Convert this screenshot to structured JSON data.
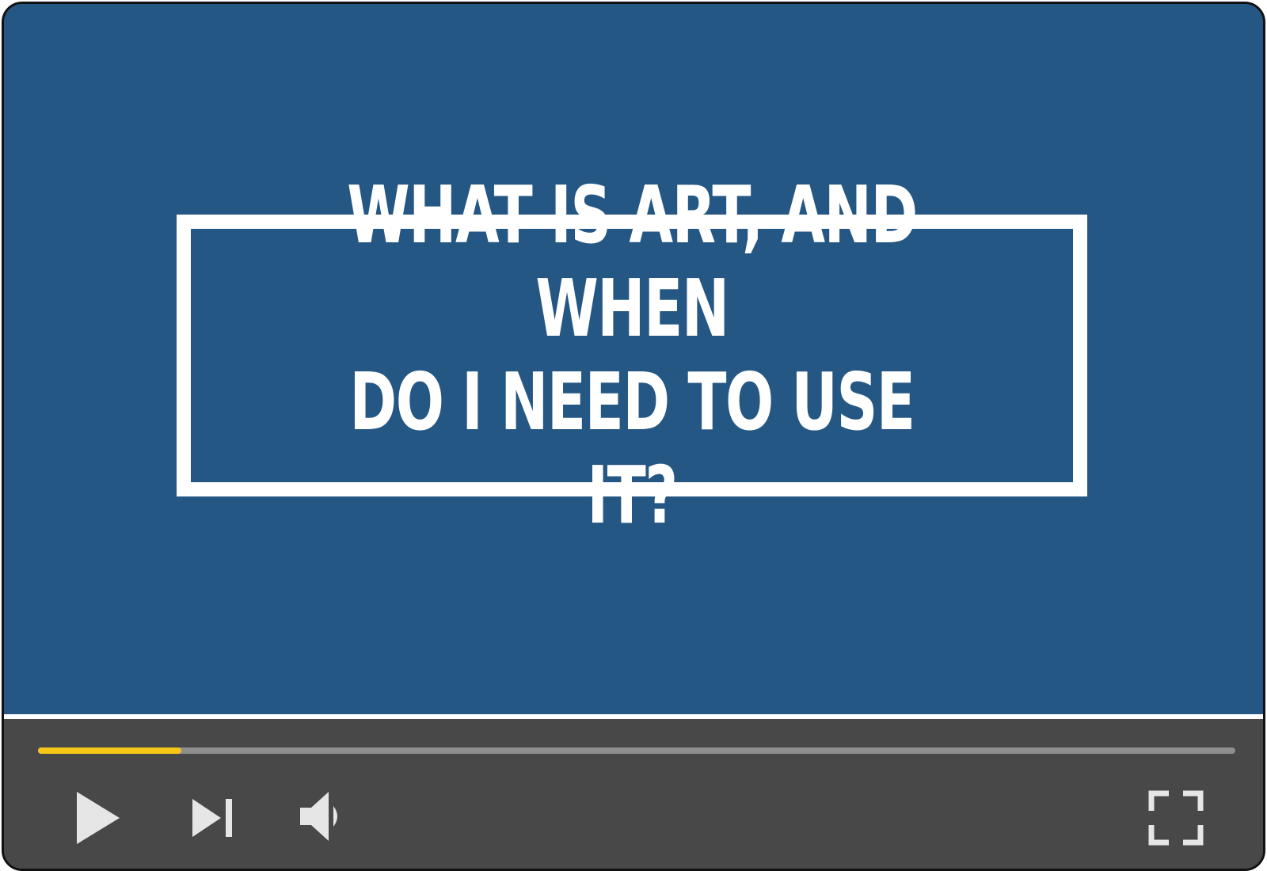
{
  "video": {
    "title_line_1": "WHAT IS ART, AND WHEN",
    "title_line_2": "DO I NEED TO USE IT?",
    "background_color": "#255784",
    "frame_color": "#ffffff"
  },
  "controls": {
    "progress_fraction": 0.12,
    "progress_color": "#f5c518",
    "track_color": "#8e8e8e",
    "bar_color": "#484848",
    "icon_color": "#e6e6e6",
    "buttons": [
      {
        "name": "play",
        "icon": "play-icon"
      },
      {
        "name": "next",
        "icon": "skip-next-icon"
      },
      {
        "name": "volume",
        "icon": "volume-icon"
      },
      {
        "name": "fullscreen",
        "icon": "fullscreen-icon"
      }
    ]
  }
}
